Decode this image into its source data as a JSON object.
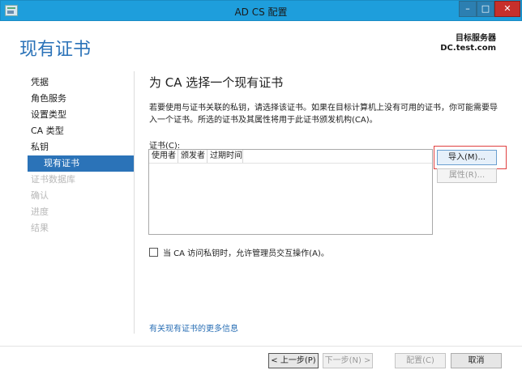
{
  "window": {
    "title": "AD CS 配置"
  },
  "header": {
    "page_title": "现有证书",
    "server_label": "目标服务器",
    "server_name": "DC.test.com"
  },
  "nav": {
    "items": [
      {
        "label": "凭据"
      },
      {
        "label": "角色服务"
      },
      {
        "label": "设置类型"
      },
      {
        "label": "CA 类型"
      },
      {
        "label": "私钥"
      },
      {
        "label": "现有证书"
      },
      {
        "label": "证书数据库"
      },
      {
        "label": "确认"
      },
      {
        "label": "进度"
      },
      {
        "label": "结果"
      }
    ]
  },
  "main": {
    "section_title": "为 CA 选择一个现有证书",
    "description": "若要使用与证书关联的私钥，请选择该证书。如果在目标计算机上没有可用的证书，你可能需要导入一个证书。所选的证书及其属性将用于此证书颁发机构(CA)。",
    "cert_label": "证书(C):",
    "columns": [
      "使用者",
      "颁发者",
      "过期时间"
    ],
    "import_button": "导入(M)...",
    "properties_button": "属性(R)...",
    "checkbox_label": "当 CA 访问私钥时，允许管理员交互操作(A)。",
    "more_link": "有关现有证书的更多信息"
  },
  "footer": {
    "prev": "< 上一步(P)",
    "next": "下一步(N) >",
    "configure": "配置(C)",
    "cancel": "取消"
  },
  "colors": {
    "titlebar": "#1e9edc",
    "accent": "#2b73b8",
    "highlight_border": "#e04040"
  }
}
